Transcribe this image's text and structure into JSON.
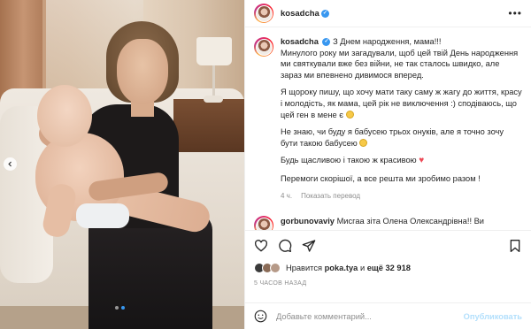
{
  "header": {
    "username": "kosadcha",
    "verified_mark": "✓",
    "more_icon": "more-horizontal-icon"
  },
  "caption": {
    "username": "kosadcha",
    "p1": "З Днем народження, мама!!!",
    "p2": "Минулого року ми загадували, щоб цей твій День народження ми святкували вже без війни, не так сталось швидко, але зараз ми впевнено дивимося вперед.",
    "p3": "Я щороку пишу, що хочу мати таку саму ж жагу до життя, красу і молодість, як мама, цей рік не виключення :) сподіваюсь, що цей ген в мене є",
    "p4": "Не знаю, чи буду я бабусею трьох онуків, але я точно зочу бути такою бабусею",
    "p5": "Будь щасливою і такою ж красивою",
    "p6": "Перемоги скорішої, а все решта ми зробимо разом !",
    "age": "4 ч.",
    "translate": "Показать перевод"
  },
  "comment": {
    "username": "gorbunovaviy",
    "text": "Мисгаа зіта Олена Олександрівна!! Ви"
  },
  "likes": {
    "prefix": "Нравится",
    "user": "poka.tya",
    "conj": "и",
    "count": "ещё 32 918"
  },
  "time": "5 ЧАСОВ НАЗАД",
  "add_comment": {
    "placeholder": "Добавьте комментарий...",
    "publish": "Опубликовать"
  },
  "carousel": {
    "total": 2,
    "current": 2
  },
  "colors": {
    "accent": "#3897f0",
    "heart": "#ed4956",
    "publish_disabled": "#b2dffc"
  }
}
